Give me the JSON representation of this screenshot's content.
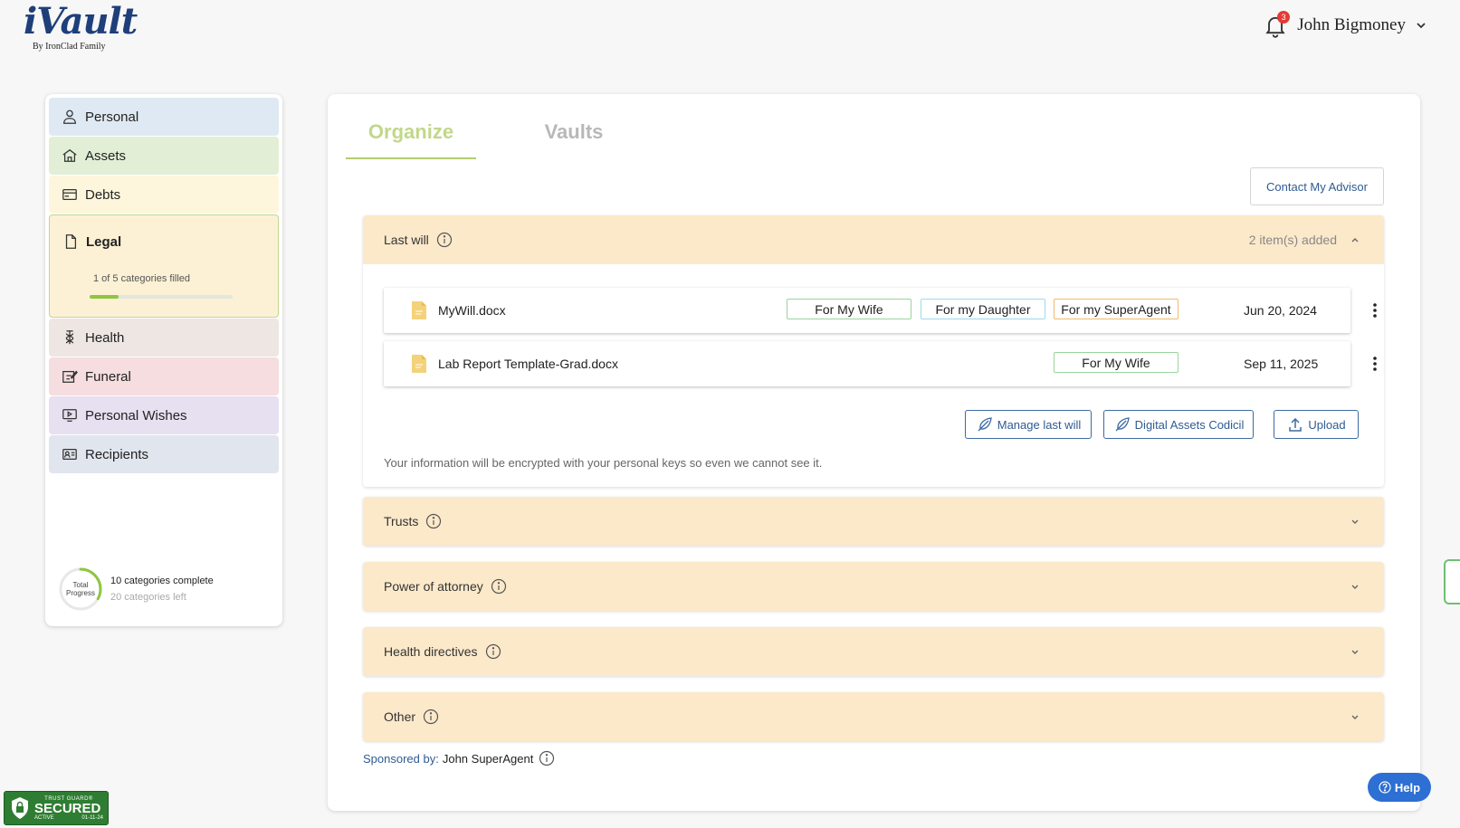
{
  "header": {
    "logo_text": "iVault",
    "logo_sub": "By IronClad Family",
    "notification_count": "3",
    "user_name": "John Bigmoney"
  },
  "sidebar": {
    "items": [
      {
        "label": "Personal",
        "icon": "person-icon",
        "color": "#dfe9f3"
      },
      {
        "label": "Assets",
        "icon": "house-icon",
        "color": "#e2efd6"
      },
      {
        "label": "Debts",
        "icon": "credit-card-icon",
        "color": "#fdf6dc"
      },
      {
        "label": "Legal",
        "icon": "document-icon",
        "color": "#fcf1d5",
        "progress_text": "1 of 5 categories filled",
        "progress": 0.2
      },
      {
        "label": "Health",
        "icon": "health-icon",
        "color": "#ede6e3"
      },
      {
        "label": "Funeral",
        "icon": "edit-note-icon",
        "color": "#f5dde0"
      },
      {
        "label": "Personal Wishes",
        "icon": "video-icon",
        "color": "#e6e0f0"
      },
      {
        "label": "Recipients",
        "icon": "contacts-icon",
        "color": "#e1e5ee"
      }
    ],
    "total_progress_label_1": "Total",
    "total_progress_label_2": "Progress",
    "total_progress_value": 0.33,
    "complete_text": "10 categories complete",
    "left_text": "20 categories left"
  },
  "tabs": [
    {
      "label": "Organize",
      "active": true
    },
    {
      "label": "Vaults",
      "active": false
    }
  ],
  "contact_advisor_label": "Contact My Advisor",
  "last_will": {
    "title": "Last will",
    "count_text": "2 item(s) added",
    "files": [
      {
        "name": "MyWill.docx",
        "tags": [
          "For My Wife",
          "For my Daughter",
          "For my SuperAgent"
        ],
        "date": "Jun 20, 2024"
      },
      {
        "name": "Lab Report Template-Grad.docx",
        "tags": [
          "For My Wife"
        ],
        "date": "Sep 11, 2025"
      }
    ],
    "actions": {
      "manage": "Manage last will",
      "codicil": "Digital Assets Codicil",
      "upload": "Upload"
    },
    "note": "Your information will be encrypted with your personal keys so even we cannot see it."
  },
  "sections": [
    {
      "title": "Trusts"
    },
    {
      "title": "Power of attorney"
    },
    {
      "title": "Health directives"
    },
    {
      "title": "Other"
    }
  ],
  "sponsored": {
    "label": "Sponsored by:",
    "name": "John SuperAgent"
  },
  "help_label": "Help",
  "trust_badge": {
    "top": "TRUST GUARD®",
    "main": "SECURED",
    "status": "ACTIVE",
    "date": "01-11-24"
  },
  "colors": {
    "accent_blue": "#2f5b92",
    "organize_green": "#c2d78a",
    "accordion_bg": "#fce9ca"
  }
}
